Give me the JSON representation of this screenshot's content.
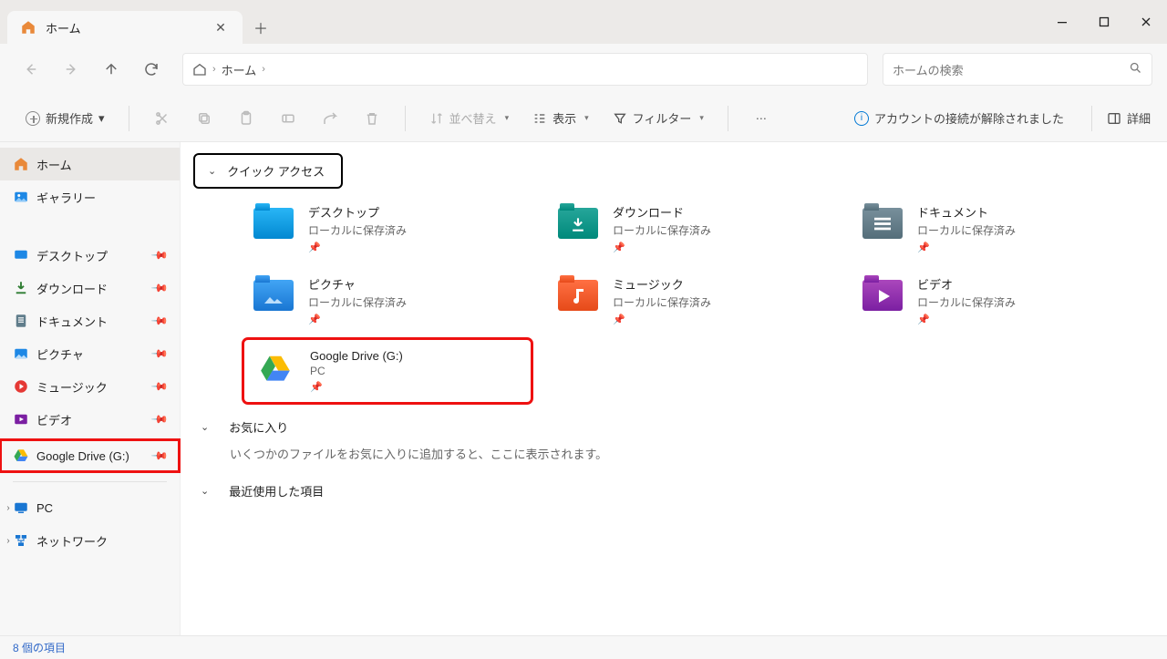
{
  "tab": {
    "title": "ホーム"
  },
  "breadcrumb": {
    "location": "ホーム"
  },
  "search": {
    "placeholder": "ホームの検索"
  },
  "toolbar": {
    "new_label": "新規作成",
    "sort_label": "並べ替え",
    "view_label": "表示",
    "filter_label": "フィルター",
    "status_msg": "アカウントの接続が解除されました",
    "details_label": "詳細"
  },
  "sidebar": {
    "home": "ホーム",
    "gallery": "ギャラリー",
    "qa": [
      {
        "label": "デスクトップ"
      },
      {
        "label": "ダウンロード"
      },
      {
        "label": "ドキュメント"
      },
      {
        "label": "ピクチャ"
      },
      {
        "label": "ミュージック"
      },
      {
        "label": "ビデオ"
      }
    ],
    "drive": "Google Drive (G:)",
    "pc": "PC",
    "network": "ネットワーク"
  },
  "sections": {
    "quick_access": "クイック アクセス",
    "favorites": "お気に入り",
    "recent": "最近使用した項目"
  },
  "quick_access": [
    {
      "name": "デスクトップ",
      "sub": "ローカルに保存済み"
    },
    {
      "name": "ダウンロード",
      "sub": "ローカルに保存済み"
    },
    {
      "name": "ドキュメント",
      "sub": "ローカルに保存済み"
    },
    {
      "name": "ピクチャ",
      "sub": "ローカルに保存済み"
    },
    {
      "name": "ミュージック",
      "sub": "ローカルに保存済み"
    },
    {
      "name": "ビデオ",
      "sub": "ローカルに保存済み"
    },
    {
      "name": "Google Drive (G:)",
      "sub": "PC"
    }
  ],
  "favorites_empty": "いくつかのファイルをお気に入りに追加すると、ここに表示されます。",
  "statusbar": {
    "count_text": "8 個の項目"
  }
}
